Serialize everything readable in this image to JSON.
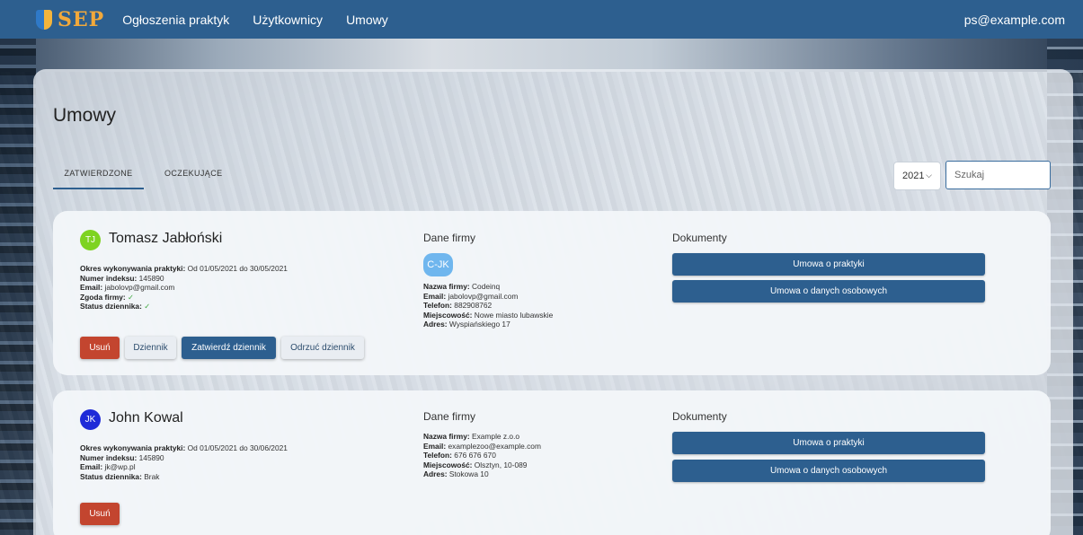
{
  "navbar": {
    "logo_text": "SEP",
    "links": [
      "Ogłoszenia praktyk",
      "Użytkownicy",
      "Umowy"
    ],
    "user_email": "ps@example.com"
  },
  "page": {
    "title": "Umowy",
    "tabs": [
      "ZATWIERDZONE",
      "OCZEKUJĄCE"
    ],
    "active_tab": "ZATWIERDZONE",
    "year": "2021",
    "search_placeholder": "Szukaj"
  },
  "labels": {
    "company_section": "Dane firmy",
    "documents_section": "Dokumenty",
    "period": "Okres wykonywania praktyki:",
    "index": "Numer indeksu:",
    "email": "Email:",
    "consent": "Zgoda firmy:",
    "journal_status": "Status dziennika:",
    "company_name": "Nazwa firmy:",
    "phone": "Telefon:",
    "city": "Miejscowość:",
    "address": "Adres:",
    "doc_contract": "Umowa o praktyki",
    "doc_personal": "Umowa o danych osobowych",
    "btn_delete": "Usuń",
    "btn_journal": "Dziennik",
    "btn_approve_journal": "Zatwierdź dziennik",
    "btn_reject_journal": "Odrzuć dziennik"
  },
  "contracts": [
    {
      "initials": "TJ",
      "avatar_color": "#7ed321",
      "name": "Tomasz Jabłoński",
      "period": "Od 01/05/2021 do 30/05/2021",
      "index": "145890",
      "email": "jabolovp@gmail.com",
      "consent": "✓",
      "journal_status": "✓",
      "company_badge": "C-JK",
      "company_name": "Codeinq",
      "company_email": "jabolovp@gmail.com",
      "phone": "882908762",
      "city": "Nowe miasto lubawskie",
      "address": "Wyspiańskiego 17"
    },
    {
      "initials": "JK",
      "avatar_color": "#1f2bd8",
      "name": "John Kowal",
      "period": "Od 01/05/2021 do 30/06/2021",
      "index": "145890",
      "email": "jk@wp.pl",
      "journal_status": "Brak",
      "company_name": "Example z.o.o",
      "company_email": "examplezoo@example.com",
      "phone": "676 676 670",
      "city": "Olsztyn, 10-089",
      "address": "Stokowa 10"
    }
  ]
}
